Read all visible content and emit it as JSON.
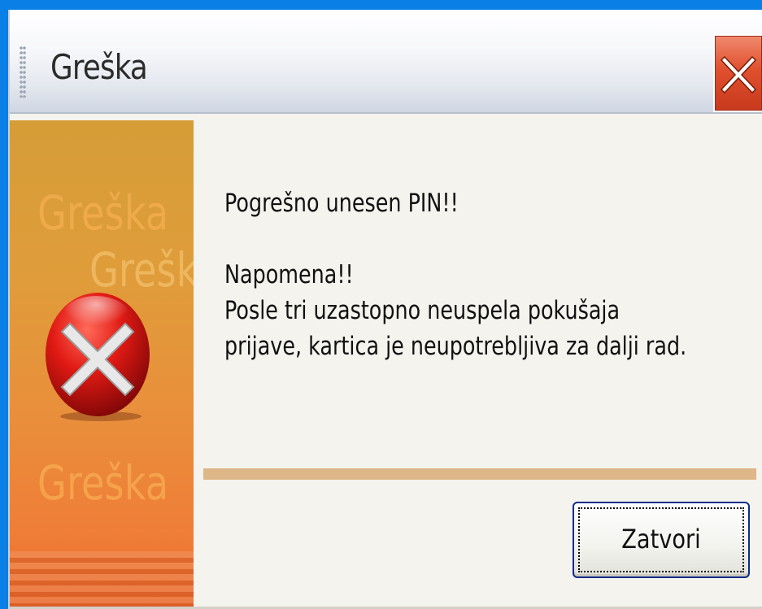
{
  "window": {
    "title": "Greška",
    "close_icon": "close-x-icon"
  },
  "side_panel": {
    "watermark_1": "Greška",
    "watermark_2": "Grešk",
    "watermark_3": "Greška",
    "icon": "error-icon"
  },
  "message": {
    "line1": "Pogrešno unesen PIN!!",
    "line2": "Napomena!!",
    "line3": "Posle tri uzastopno neuspela pokušaja",
    "line4": "prijave, kartica je neupotrebljiva za dalji rad."
  },
  "buttons": {
    "close_label": "Zatvori"
  },
  "colors": {
    "desktop": "#0a7fe6",
    "close_button": "#e0502e",
    "panel_orange": "#e98f3b",
    "separator": "#ddb788",
    "button_border": "#0b2c8a"
  }
}
